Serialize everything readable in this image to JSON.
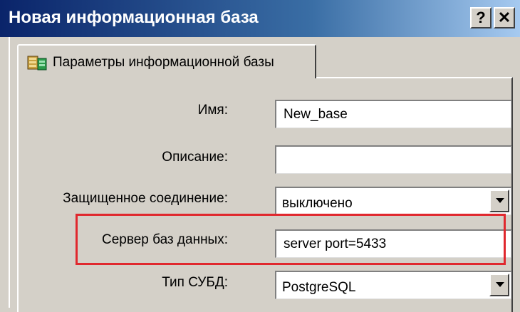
{
  "window": {
    "title": "Новая информационная база",
    "help_label": "?",
    "close_label": "✕"
  },
  "tab": {
    "label": "Параметры информационной базы",
    "icon": "database-settings-icon"
  },
  "form": {
    "name_label": "Имя:",
    "name_value": "New_base",
    "description_label": "Описание:",
    "description_value": "",
    "secure_connection_label": "Защищенное соединение:",
    "secure_connection_value": "выключено",
    "db_server_label": "Сервер баз данных:",
    "db_server_value": "server port=5433",
    "dbms_type_label": "Тип СУБД:",
    "dbms_type_value": "PostgreSQL"
  },
  "colors": {
    "title_bar_start": "#0a246a",
    "title_bar_end": "#a6caf0",
    "highlight": "#e0282e",
    "dialog_bg": "#d4d0c8"
  }
}
